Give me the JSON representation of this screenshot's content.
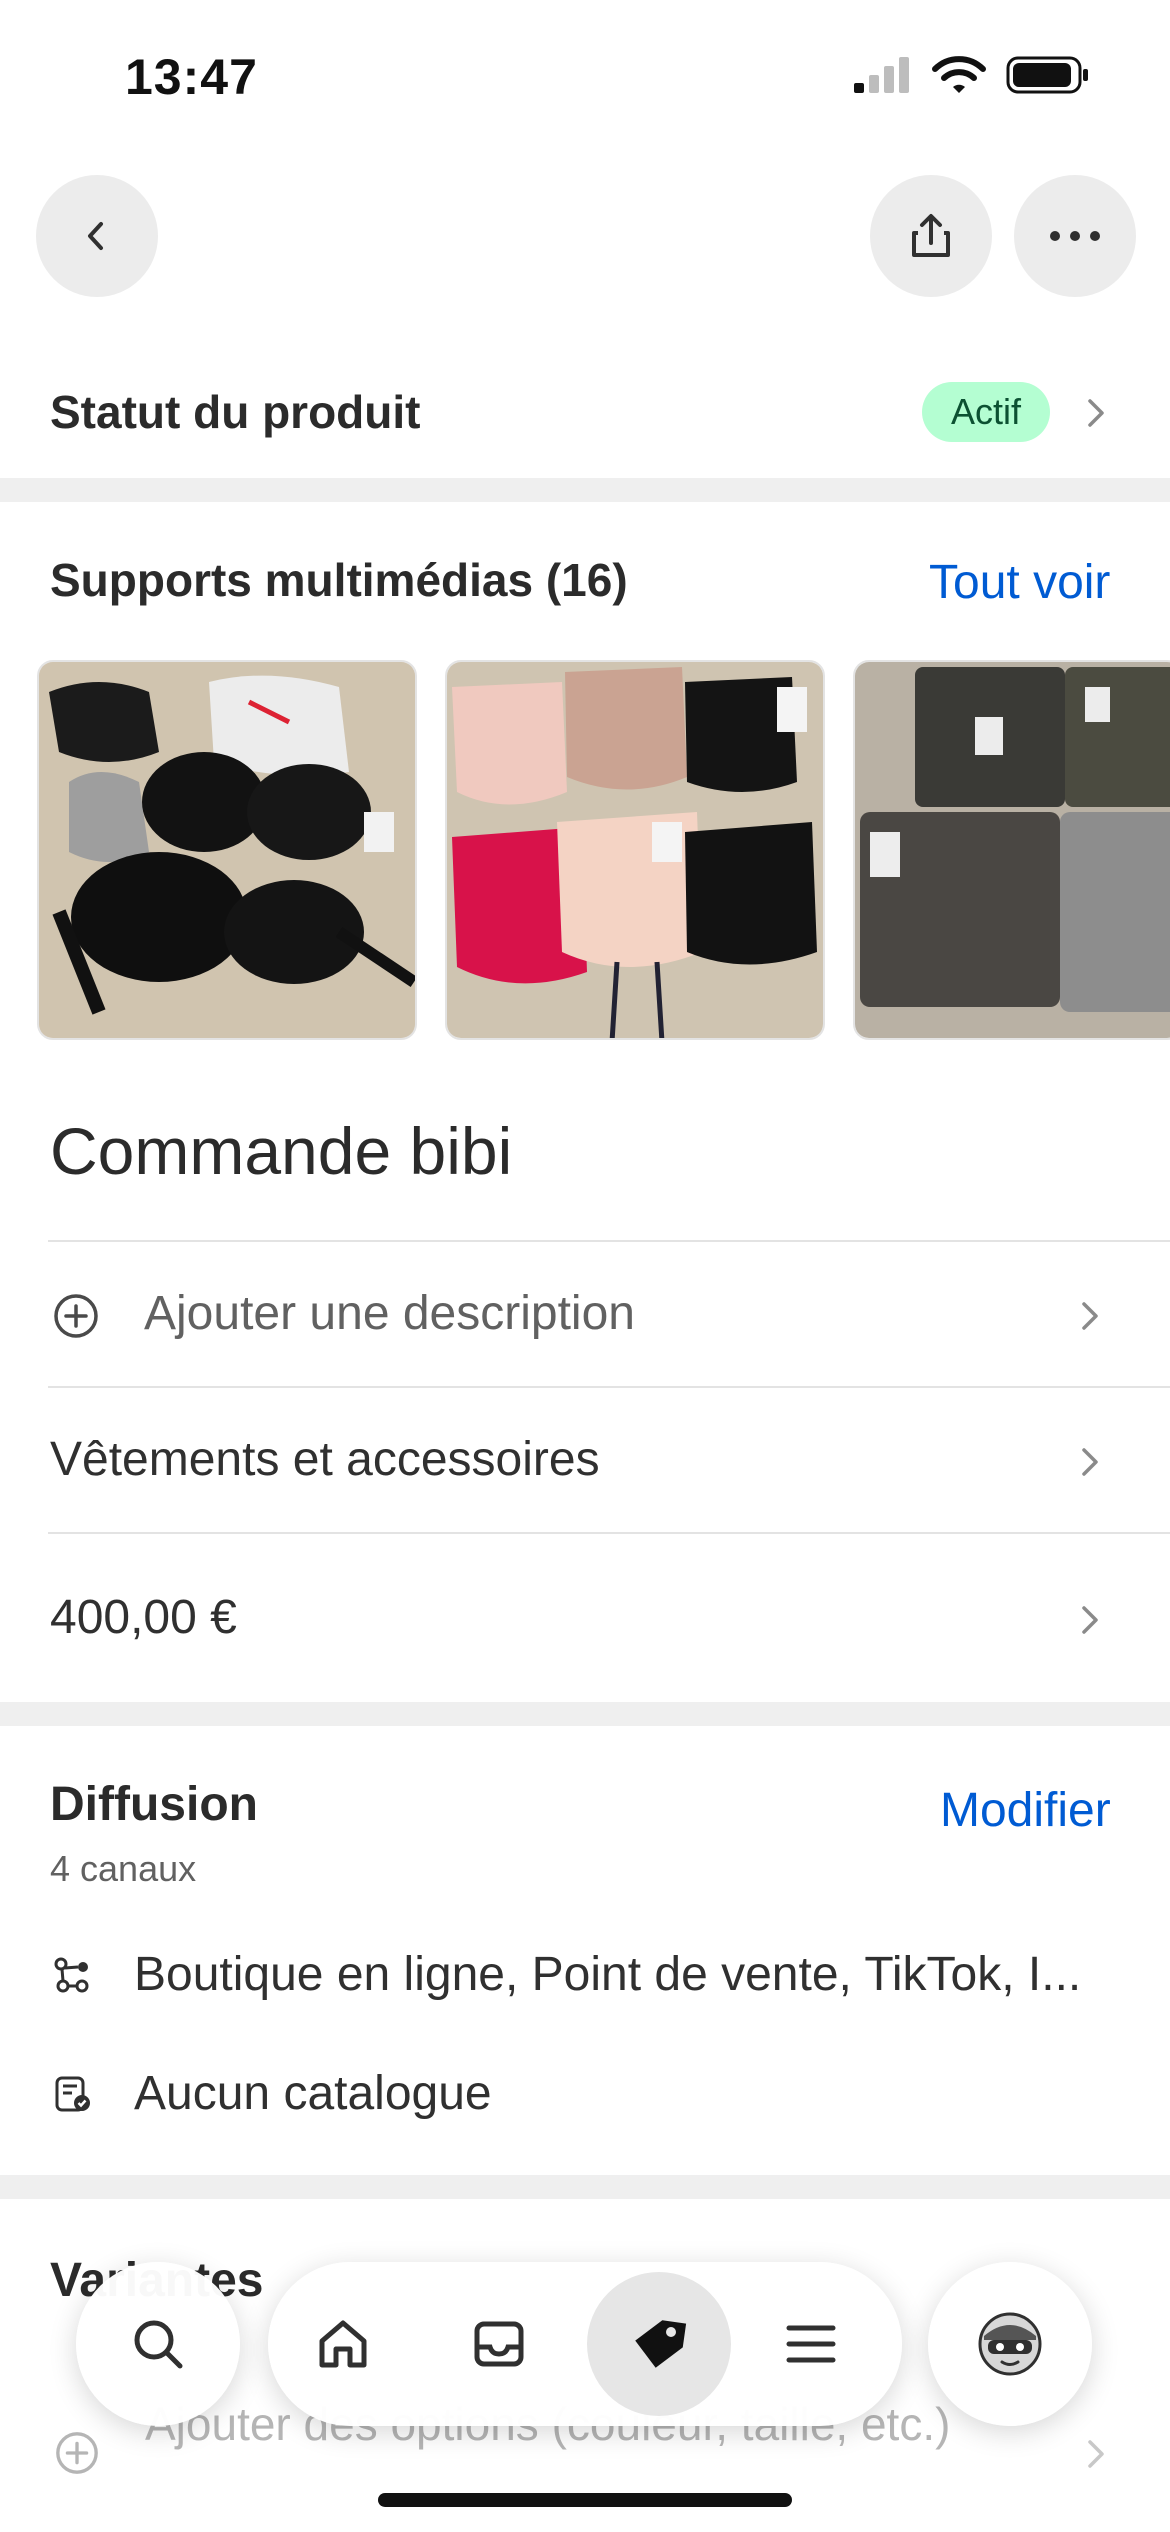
{
  "status_bar": {
    "time": "13:47"
  },
  "header": {
    "back_icon": "chevron-left-icon",
    "share_icon": "share-icon",
    "more_icon": "more-horizontal-icon"
  },
  "product_status": {
    "label": "Statut du produit",
    "badge": "Actif",
    "badge_color": "#b4fed2"
  },
  "media": {
    "title": "Supports multimédias (16)",
    "see_all": "Tout voir",
    "thumbnails": [
      "lingerie-photo-1",
      "lingerie-photo-2",
      "lingerie-photo-3"
    ]
  },
  "product": {
    "title": "Commande bibi",
    "add_description": "Ajouter une description",
    "category": "Vêtements et accessoires",
    "price": "400,00 €"
  },
  "distribution": {
    "title": "Diffusion",
    "subtitle": "4 canaux",
    "edit": "Modifier",
    "channels": "Boutique en ligne, Point de vente, TikTok, I...",
    "catalog": "Aucun catalogue"
  },
  "variants": {
    "title": "Variantes",
    "add_options": "Ajouter des options (couleur, taille, etc.)"
  },
  "bottom_nav": {
    "items": [
      "search-icon",
      "home-icon",
      "inbox-icon",
      "tag-icon",
      "menu-icon",
      "avatar-icon"
    ],
    "active": "tag-icon"
  },
  "colors": {
    "accent": "#005bd3",
    "badge_bg": "#b4fed2",
    "badge_text": "#0c5132",
    "band": "#efefef"
  }
}
